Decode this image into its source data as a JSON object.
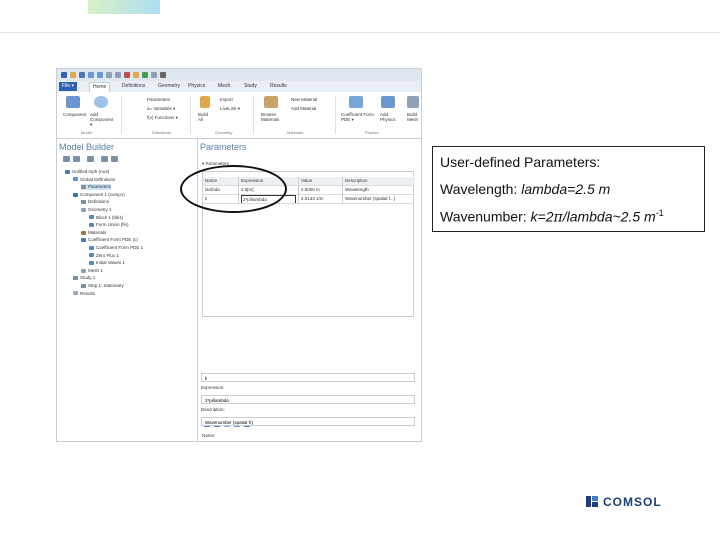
{
  "window": {
    "quick_access_icons": [
      "new-icon",
      "open-icon",
      "save-icon",
      "undo-icon",
      "redo-icon",
      "copy-icon",
      "paste-icon",
      "delete-icon",
      "build-icon",
      "compute-icon",
      "settings-icon",
      "dropdown-icon"
    ],
    "tabs": [
      {
        "label": "File ▾",
        "active": false
      },
      {
        "label": "Home",
        "active": true
      },
      {
        "label": "Definitions",
        "active": false
      },
      {
        "label": "Geometry",
        "active": false
      },
      {
        "label": "Physics",
        "active": false
      },
      {
        "label": "Mesh",
        "active": false
      },
      {
        "label": "Study",
        "active": false
      },
      {
        "label": "Results",
        "active": false
      }
    ],
    "ribbon": {
      "component_label": "Component",
      "add_component_label": "Add Component ▾",
      "parameters_label": "Parameters",
      "variables_label": "a= Variables ▾",
      "functions_label": "f(x) Functions ▾",
      "import_label": "Import",
      "livelink_label": "LiveLink ▾",
      "build_all_label": "Build All",
      "browse_materials_label": "Browse Materials",
      "new_material_label": "New Material",
      "add_material_label": "Add Material",
      "coefficient_form_label": "Coefficient Form PDE ▾",
      "add_physics_label": "Add Physics",
      "build_mesh_label": "Build Mesh",
      "groups": [
        "Model",
        "Definitions",
        "Geometry",
        "Materials",
        "Physics"
      ]
    },
    "model_builder": {
      "title": "Model Builder",
      "tree": [
        {
          "label": "Untitled.mph (root)",
          "depth": 0,
          "icon": "root-icon",
          "color": "#4a78b8",
          "selected": false
        },
        {
          "label": "Global Definitions",
          "depth": 1,
          "icon": "globe-icon",
          "color": "#6a8fc4",
          "selected": false
        },
        {
          "label": "Parameters",
          "depth": 2,
          "icon": "parameters-icon",
          "color": "#8a8a8a",
          "selected": true
        },
        {
          "label": "Component 1 (comp1)",
          "depth": 1,
          "icon": "component-icon",
          "color": "#3f6fb0",
          "selected": false
        },
        {
          "label": "Definitions",
          "depth": 2,
          "icon": "definitions-icon",
          "color": "#7a8aa0",
          "selected": false
        },
        {
          "label": "Geometry 1",
          "depth": 2,
          "icon": "geometry-icon",
          "color": "#8da3be",
          "selected": false
        },
        {
          "label": "Block 1 (blk1)",
          "depth": 3,
          "icon": "block-icon",
          "color": "#5b86bf",
          "selected": false
        },
        {
          "label": "Form Union (fin)",
          "depth": 3,
          "icon": "union-icon",
          "color": "#5b86bf",
          "selected": false
        },
        {
          "label": "Materials",
          "depth": 2,
          "icon": "materials-icon",
          "color": "#9a7a55",
          "selected": false
        },
        {
          "label": "Coefficient Form PDE (c)",
          "depth": 2,
          "icon": "pde-icon",
          "color": "#4a78b8",
          "selected": false
        },
        {
          "label": "Coefficient Form PDE 1",
          "depth": 3,
          "icon": "pde-node-icon",
          "color": "#5b86bf",
          "selected": false
        },
        {
          "label": "Zero Flux 1",
          "depth": 3,
          "icon": "flux-icon",
          "color": "#5b86bf",
          "selected": false
        },
        {
          "label": "Initial Values 1",
          "depth": 3,
          "icon": "initial-values-icon",
          "color": "#5b86bf",
          "selected": false
        },
        {
          "label": "Mesh 1",
          "depth": 2,
          "icon": "mesh-icon",
          "color": "#8fa1b6",
          "selected": false
        },
        {
          "label": "Study 1",
          "depth": 1,
          "icon": "study-icon",
          "color": "#7a8aa0",
          "selected": false
        },
        {
          "label": "Step 1: Stationary",
          "depth": 2,
          "icon": "step-icon",
          "color": "#7a8aa0",
          "selected": false
        },
        {
          "label": "Results",
          "depth": 1,
          "icon": "results-icon",
          "color": "#9aa9bc",
          "selected": false
        }
      ]
    },
    "parameters_panel": {
      "title": "Parameters",
      "section": "▾ Parameters",
      "columns": [
        "Name",
        "Expression",
        "Value",
        "Description"
      ],
      "rows": [
        [
          "lambda",
          "2.5[m]",
          "2.5000 m",
          "Wavelength"
        ],
        [
          "k",
          "2*pi/lambda",
          "2.5133 1/m",
          "Wavenumber (spatial f...)"
        ]
      ],
      "name_label": "Name:",
      "name_value": "k",
      "expression_label": "Expression:",
      "expression_value": "2*pi/lambda",
      "description_label": "Description:",
      "description_value": "Wavenumber (spatial fr)"
    }
  },
  "info": {
    "heading": "User-defined Parameters:",
    "wavelength_prefix": "Wavelength: ",
    "wavelength_expr": "lambda=2.5 m",
    "wavenumber_prefix": "Wavenumber: ",
    "wavenumber_k": "k=2",
    "wavenumber_pi": "π",
    "wavenumber_rest": "/lambda~2.5 m",
    "wavenumber_exp": "-1"
  },
  "brand": {
    "name": "COMSOL",
    "color": "#1b3f7a"
  }
}
